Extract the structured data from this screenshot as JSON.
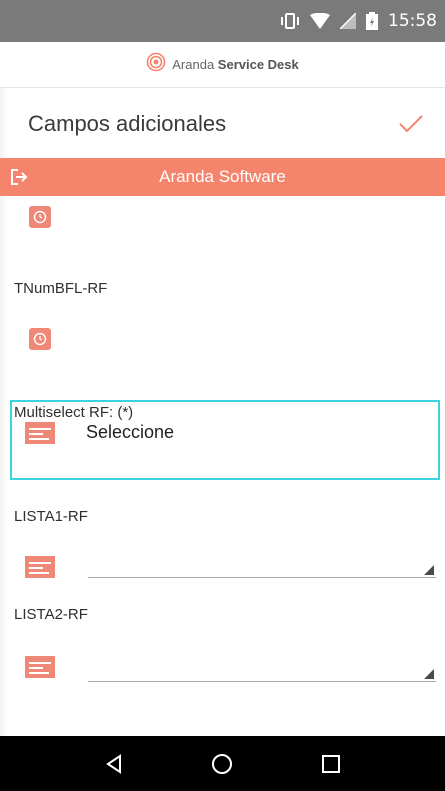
{
  "status_bar": {
    "time": "15:58",
    "icons": [
      "vibrate-icon",
      "wifi-icon",
      "signal-icon",
      "battery-icon"
    ]
  },
  "brand": {
    "name_light": "Aranda",
    "name_bold": "Service Desk"
  },
  "header": {
    "title": "Campos adicionales"
  },
  "band": {
    "title": "Aranda Software"
  },
  "fields": {
    "tnum": {
      "label": "TNumBFL-RF"
    },
    "multiselect": {
      "label": "Multiselect RF: (*)",
      "value": "Seleccione"
    },
    "lista1": {
      "label": "LISTA1-RF"
    },
    "lista2": {
      "label": "LISTA2-RF"
    }
  },
  "colors": {
    "accent": "#f4846c",
    "focus": "#3ad3e0",
    "statusbar": "#7a7a7a"
  },
  "navbar": {
    "buttons": [
      "back-icon",
      "home-icon",
      "recents-icon"
    ]
  }
}
